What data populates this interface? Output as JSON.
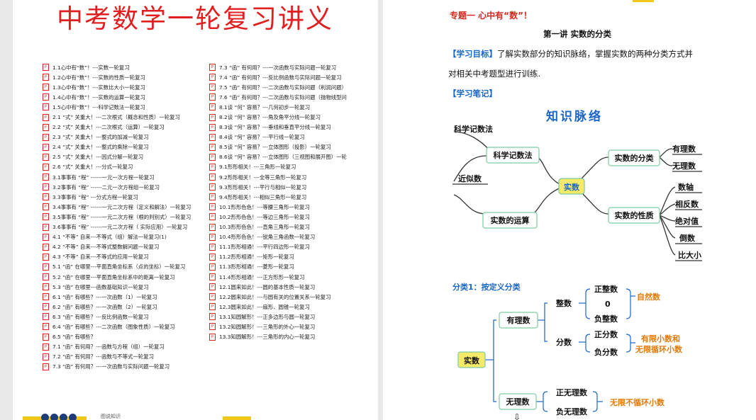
{
  "left_page": {
    "title": "中考数学一轮复习讲义",
    "toc_left": [
      "1.1心中有“数”！---实数一轮复习",
      "1.2心中有“数”！---实数的性质一轮复习",
      "1.3心中有“数”！---实数比大小一轮复习",
      "1.4心中有“数”！---实数的运算一轮复习",
      "1.5心中有“数”！---科学记数法一轮复习",
      "2.1 “式” 关重大！---二次根式（概念和性质）一轮复习",
      "2.2 “式” 关重大！---二次根式（运算）一轮复习",
      "2.3 “式” 关重大！---整式的加减一轮复习",
      "2.4 “式” 关重大！---整式的乘除一轮复习",
      "2.5 “式” 关重大！---因式分解一轮复习",
      "2.6 “式” 关重大！---分式一轮复习",
      "3.1事事有 “程” ------一元一次方程一轮复习",
      "3.2事事有 “程” ------二元一次方程组一轮复习",
      "3.3事事有 “程” ---分式方程一轮复习",
      "3.4事事有 “程” ------一元二次方程（定义和解法）一轮复习",
      "3.5事事有 “程” ------一元二次方程（根的判别式）一轮复习",
      "3.6事事有 “程” ------一元二次方程（ 实际应用）一轮复习",
      "4.1 “不等” 自来---不等式（组）解法一轮复习(1)",
      "4.2 “不等” 自来---不等式整数解问题一轮复习",
      "4.3 “不等” 自来---不等式的应用一轮复习",
      "5.1 “函” 在哪里---平面直角坐标系（点的坐标）一轮复习",
      "5.2 “函” 在哪里---平面直角坐标系中的距离一轮复习",
      "5.3 “函” 在哪里---函数基础知识一轮复习",
      "6.1 “函” 有哪些？---一次函数（1）一轮复习",
      "6.2 “函” 有哪些？---一次函数（2）一轮复习",
      "6.3 “函” 有哪些？---反比例函数一轮复习",
      "6.4 “函” 有哪些？---二次函数（图象性质）一轮复习",
      "6.5 “函” 有哪些？",
      "7.1 “函” 有何用？---函数与方程（组）一轮复习",
      "7.2 “函” 有何用？---函数与不等式一轮复习",
      "7.3 “函” 有何用？---一次函数与实际问题一轮复习"
    ],
    "toc_right": [
      "7.3 “函” 有何用？---一次函数与实际问题一轮复习",
      "7.4 “函” 有何用？---反比例函数与实际问题一轮复习",
      "7.5 “函” 有何用？---二次函数与实际问题（利润问题）",
      "7.6 “函” 有何用？---二次函数与实际问题（抛物线型问",
      "8.1谈 “何” 容易？---几何初步一轮复习",
      "8.2谈 “何” 容易？---角及角平分线一轮复习",
      "8.3谈 “何” 容易？---垂线和垂直平分线一轮复习",
      "8.4谈 “何” 容易？---平行线一轮复习",
      "8.5谈 “何” 容易？---立体图形（投影）一轮复习",
      "8.6谈 “何” 容易？---立体图形（三视图和展开图）一轮",
      "9.1形形相关！---三角形一轮复习",
      "9.2形形相关！---全等三角形一轮复习",
      "9.3形形相关！---平行与相似一轮复习",
      "9.4形形相关！---相似三角形一轮复习",
      "10.1形形色色！---等腰三角形一轮复习",
      "10.2形形色色！---等边三角形一轮复习",
      "10.3形形色色！---直角三角形一轮复习",
      "10.4形形色色！---锐角三角函数一轮复习",
      "11.1形形相通！---平行四边形一轮复习",
      "11.2形形相通！---矩形一轮复习",
      "11.3形形相通！---菱形一轮复习",
      "11.4形形相通！---正方形形一轮复习",
      "12.1圆来如此！---圆的基本性质一轮复习",
      "12.2圆来如此！---与圆有关的位置关系一轮复习",
      "12.3圆来如此！---扇形、圆锥一轮复习",
      "13.1知圆解形！---正多边形与圆一轮复习",
      "13.2知圆解形！---三角形的外心一轮复习",
      "13.3知圆解形！---三角形的内心一轮复习"
    ],
    "footer_text": "图说知识"
  },
  "right_page": {
    "topic_header": "专题一 心中有“数”！",
    "lecture_title": "第一讲  实数的分类",
    "objective_label": "【学习目标】",
    "objective_text_1": "了解实数部分的知识脉络，掌握实数的两种分类方式并",
    "objective_text_2": "对相关中考题型进行训练.",
    "notes_label": "【学习笔记】",
    "mindmap": {
      "title": "知识脉络",
      "center": "实数",
      "branch_sci": "科学记数法",
      "branch_approx": "近似数",
      "branch_sci_top": "科学记数法",
      "branch_ops": "实数的运算",
      "branch_class": "实数的分类",
      "class_children": [
        "有理数",
        "无理数"
      ],
      "branch_props": "实数的性质",
      "props_children": [
        "数轴",
        "相反数",
        "绝对值",
        "倒数",
        "比大小"
      ]
    },
    "classification": {
      "heading": "分类1：按定义分类",
      "root": "实数",
      "rational": "有理数",
      "integer": "整数",
      "int_children": [
        "正整数",
        "0",
        "负整数"
      ],
      "int_note": "自然数",
      "fraction": "分数",
      "frac_children": [
        "正分数",
        "负分数"
      ],
      "frac_note_1": "有限小数和",
      "frac_note_2": "无限循环小数",
      "irrational": "无理数",
      "irr_children": [
        "正无理数",
        "负无理数"
      ],
      "irr_note": "无限不循环小数",
      "arrow": "⇩"
    },
    "colors": {
      "blue": "#1a66c7",
      "red": "#d8261c",
      "orange": "#e07a0a",
      "yellow": "#f5e96a",
      "green": "#7ec9a0"
    }
  }
}
